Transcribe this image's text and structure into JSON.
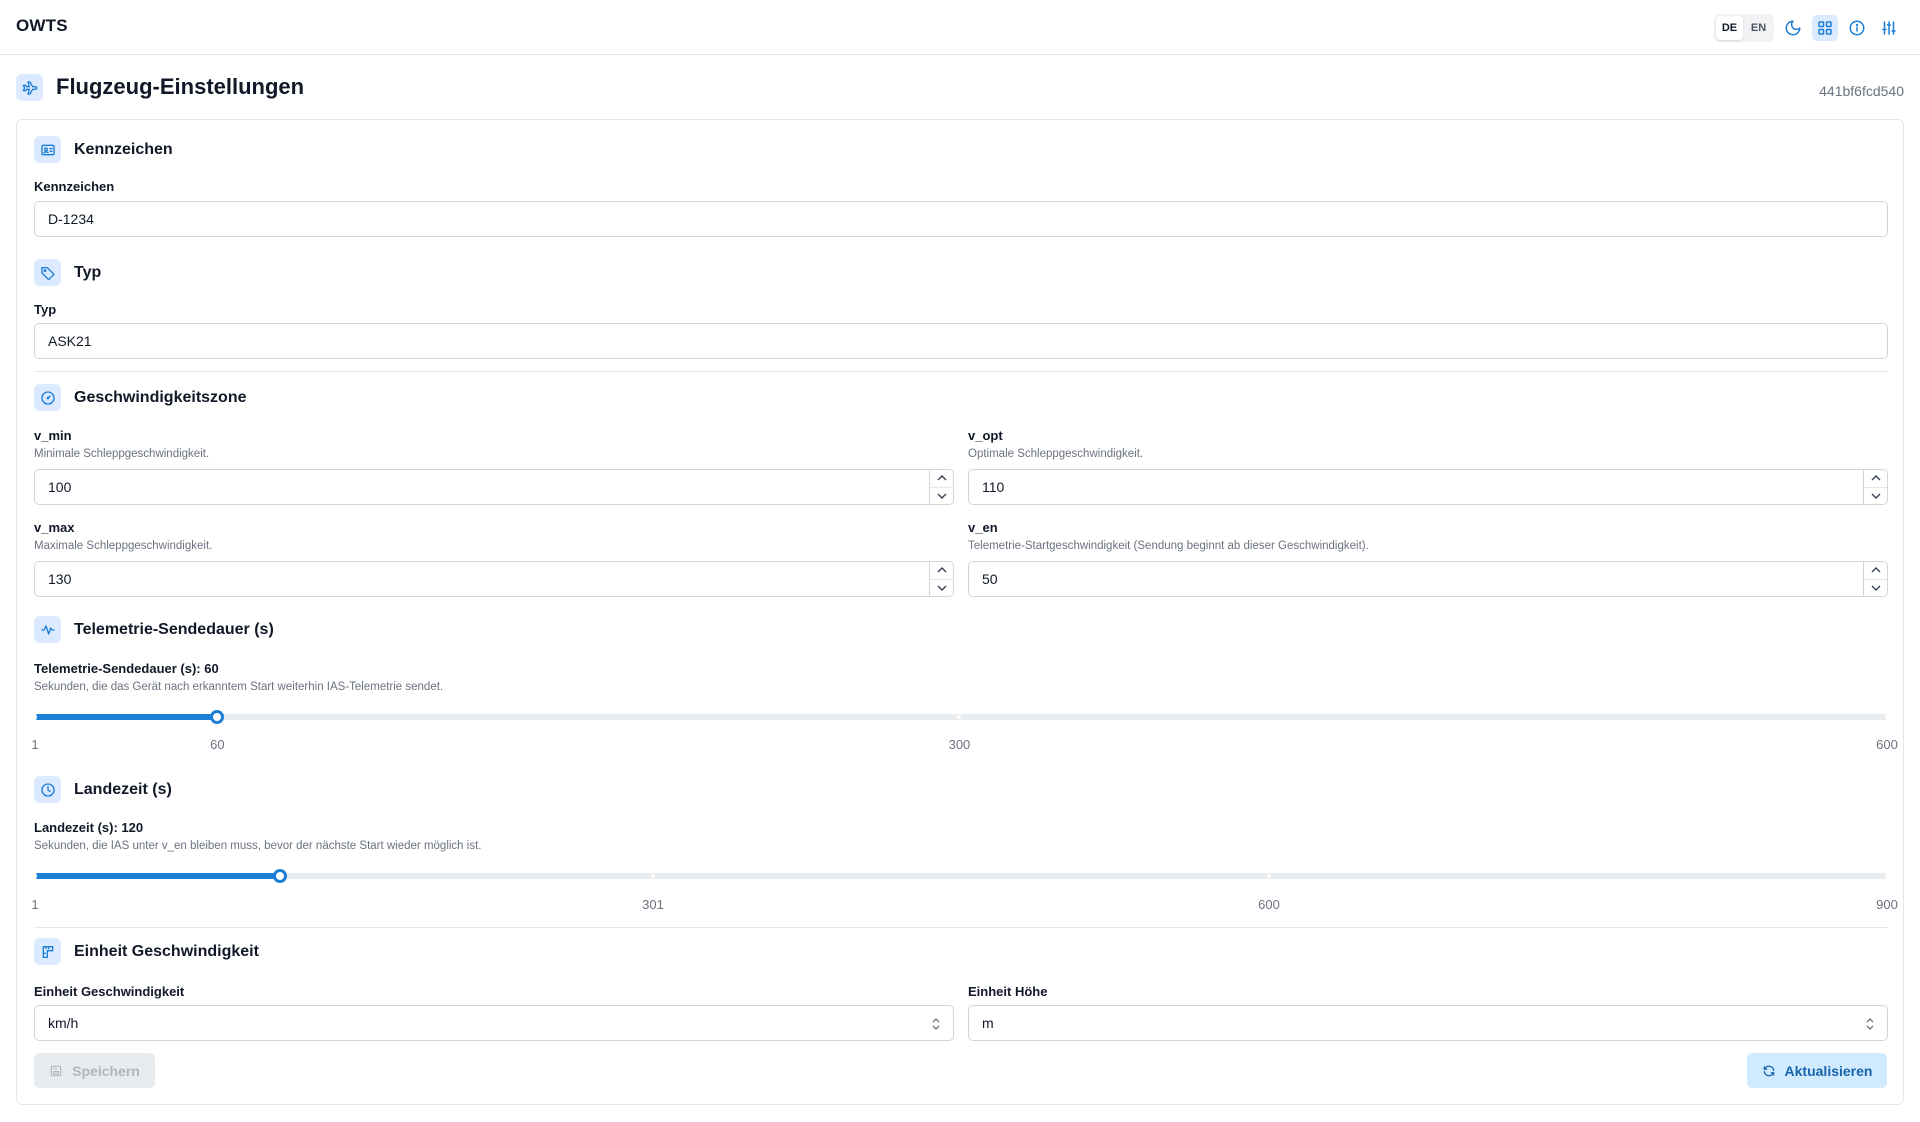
{
  "app": {
    "title": "OWTS"
  },
  "header": {
    "languages": [
      {
        "code": "DE",
        "active": true
      },
      {
        "code": "EN",
        "active": false
      }
    ],
    "icons": [
      "moon-icon",
      "layout-grid-icon",
      "info-icon",
      "sliders-icon"
    ]
  },
  "page": {
    "title": "Flugzeug-Einstellungen",
    "device_id": "441bf6fcd540"
  },
  "registration": {
    "section_title": "Kennzeichen",
    "label": "Kennzeichen",
    "value": "D-1234"
  },
  "type": {
    "section_title": "Typ",
    "label": "Typ",
    "value": "ASK21"
  },
  "speed_zone": {
    "section_title": "Geschwindigkeitszone",
    "v_min": {
      "label": "v_min",
      "help": "Minimale Schleppgeschwindigkeit.",
      "value": "100"
    },
    "v_opt": {
      "label": "v_opt",
      "help": "Optimale Schleppgeschwindigkeit.",
      "value": "110"
    },
    "v_max": {
      "label": "v_max",
      "help": "Maximale Schleppgeschwindigkeit.",
      "value": "130"
    },
    "v_en": {
      "label": "v_en",
      "help": "Telemetrie-Startgeschwindigkeit (Sendung beginnt ab dieser Geschwindigkeit).",
      "value": "50"
    }
  },
  "telemetry": {
    "section_title": "Telemetrie-Sendedauer (s)",
    "label": "Telemetrie-Sendedauer (s): 60",
    "help": "Sekunden, die das Gerät nach erkanntem Start weiterhin IAS-Telemetrie sendet.",
    "min": 1,
    "max": 600,
    "value": 60,
    "ticks": [
      "1",
      "60",
      "300",
      "600"
    ]
  },
  "landing": {
    "section_title": "Landezeit (s)",
    "label": "Landezeit (s): 120",
    "help": "Sekunden, die IAS unter v_en bleiben muss, bevor der nächste Start wieder möglich ist.",
    "min": 1,
    "max": 900,
    "value": 120,
    "ticks": [
      "1",
      "301",
      "600",
      "900"
    ]
  },
  "units": {
    "section_title": "Einheit Geschwindigkeit",
    "speed": {
      "label": "Einheit Geschwindigkeit",
      "value": "km/h"
    },
    "height": {
      "label": "Einheit Höhe",
      "value": "m"
    }
  },
  "actions": {
    "save_label": "Speichern",
    "save_disabled": true,
    "refresh_label": "Aktualisieren"
  },
  "colors": {
    "accent": "#1c7ed6",
    "accent_light": "#dbeafe",
    "refresh_bg": "#d0ebff",
    "refresh_text": "#1864ab"
  }
}
